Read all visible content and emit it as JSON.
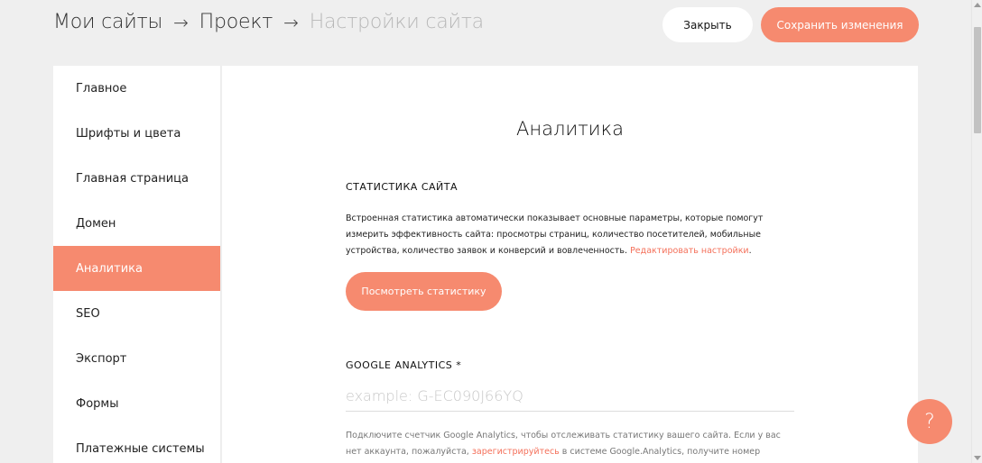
{
  "header": {
    "breadcrumb": [
      "Мои сайты",
      "Проект",
      "Настройки сайта"
    ],
    "arrow": "→",
    "close_label": "Закрыть",
    "save_label": "Сохранить изменения"
  },
  "sidebar": {
    "items": [
      {
        "label": "Главное"
      },
      {
        "label": "Шрифты и цвета"
      },
      {
        "label": "Главная страница"
      },
      {
        "label": "Домен"
      },
      {
        "label": "Аналитика",
        "active": true
      },
      {
        "label": "SEO"
      },
      {
        "label": "Экспорт"
      },
      {
        "label": "Формы"
      },
      {
        "label": "Платежные системы"
      }
    ]
  },
  "main": {
    "title": "Аналитика",
    "stats": {
      "label": "СТАТИСТИКА САЙТА",
      "description": "Встроенная статистика автоматически показывает основные параметры, которые помогут измерить эффективность сайта: просмотры страниц, количество посетителей, мобильные устройства, количество заявок и конверсий и вовлеченность.",
      "link": "Редактировать настройки",
      "link_suffix": ".",
      "button": "Посмотреть статистику"
    },
    "ga": {
      "label": "GOOGLE ANALYTICS *",
      "placeholder": "example: G-EC090J66YQ",
      "value": "",
      "desc_before": "Подключите счетчик Google Analytics, чтобы отслеживать статистику вашего сайта. Если у вас нет аккаунта, пожалуйста,",
      "desc_link": "зарегистрируйтесь",
      "desc_after": "в системе Google.Analytics, получите номер счетчика и"
    }
  },
  "help": {
    "label": "?"
  },
  "colors": {
    "accent": "#f68a6f",
    "link": "#f4705a",
    "background": "#efefef"
  }
}
